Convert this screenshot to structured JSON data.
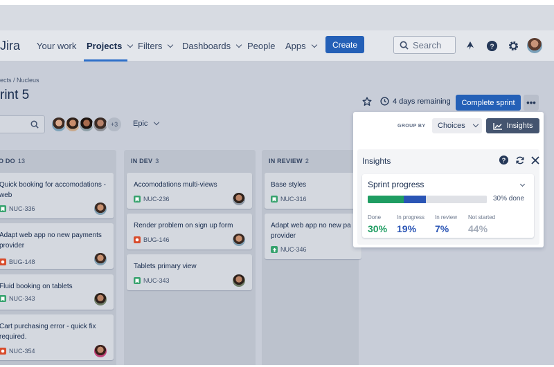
{
  "nav": {
    "logo": "Jira",
    "items": [
      {
        "label": "Your work",
        "has_menu": false
      },
      {
        "label": "Projects",
        "has_menu": true,
        "active": true
      },
      {
        "label": "Filters",
        "has_menu": true
      },
      {
        "label": "Dashboards",
        "has_menu": true
      },
      {
        "label": "People",
        "has_menu": false
      },
      {
        "label": "Apps",
        "has_menu": true
      }
    ],
    "create_label": "Create",
    "search_placeholder": "Search",
    "icons": [
      "notification-icon",
      "help-icon",
      "settings-icon",
      "profile-avatar"
    ]
  },
  "page": {
    "breadcrumb": "ects / Nucleus",
    "title": "rint 5",
    "days_remaining": "4 days remaining",
    "complete_label": "Complete sprint",
    "more_label": "•••"
  },
  "filters": {
    "avatars_extra": "+3",
    "epic_label": "Epic"
  },
  "columns": [
    {
      "title": "O DO",
      "count": "13",
      "cards": [
        {
          "text": "Quick booking for accomodations - web",
          "key": "NUC-336",
          "type": "story"
        },
        {
          "text": "Adapt web app no new payments provider",
          "key": "BUG-148",
          "type": "bug"
        },
        {
          "text": "Fluid booking on tablets",
          "key": "NUC-343",
          "type": "story"
        },
        {
          "text": "Cart purchasing error - quick fix required.",
          "key": "NUC-354",
          "type": "bug"
        }
      ]
    },
    {
      "title": "IN DEV",
      "count": "3",
      "cards": [
        {
          "text": "Accomodations multi-views",
          "key": "NUC-236",
          "type": "story"
        },
        {
          "text": "Render problem on sign up form",
          "key": "BUG-146",
          "type": "bug"
        },
        {
          "text": "Tablets primary view",
          "key": "NUC-343",
          "type": "story"
        }
      ]
    },
    {
      "title": "IN REVIEW",
      "count": "2",
      "cards": [
        {
          "text": "Base styles",
          "key": "NUC-316",
          "type": "story"
        },
        {
          "text": "Adapt web app no new pa provider",
          "key": "NUC-346",
          "type": "up"
        }
      ]
    }
  ],
  "insights_panel": {
    "group_by_label": "GROUP BY",
    "choices_label": "Choices",
    "insights_button": "Insights",
    "title": "Insights",
    "sprint_progress": {
      "title": "Sprint progress",
      "done_summary": "30% done",
      "segments": [
        {
          "name": "Done",
          "fraction": 0.3,
          "color": "#1f9d62"
        },
        {
          "name": "In progress",
          "fraction": 0.19,
          "color": "#2a55b5"
        },
        {
          "name": "In review",
          "fraction": 0.07,
          "color": "#dfe1e6"
        },
        {
          "name": "Not started",
          "fraction": 0.44,
          "color": "#dfe1e6"
        }
      ],
      "stats": [
        {
          "label": "Done",
          "value": "30%",
          "color": "#1f9d62"
        },
        {
          "label": "In progress",
          "value": "19%",
          "color": "#2a55b5"
        },
        {
          "label": "In review",
          "value": "7%",
          "color": "#2a55b5"
        },
        {
          "label": "Not started",
          "value": "44%",
          "color": "#a5adba"
        }
      ]
    }
  }
}
